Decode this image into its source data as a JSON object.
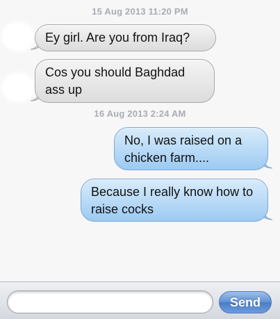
{
  "thread": {
    "timestamps": [
      "15 Aug 2013 11:20 PM",
      "16 Aug 2013 2:24 AM"
    ],
    "messages": [
      {
        "direction": "received",
        "text": "Ey girl. Are you from Iraq?"
      },
      {
        "direction": "received",
        "text": "Cos you should Baghdad ass up"
      },
      {
        "direction": "sent",
        "text": "No, I was raised on a chicken farm...."
      },
      {
        "direction": "sent",
        "text": "Because I really know how to raise cocks"
      }
    ]
  },
  "composer": {
    "input_value": "",
    "send_label": "Send"
  },
  "colors": {
    "received_bubble": "#e6e6e6",
    "sent_bubble": "#b5d8f7",
    "send_button": "#5f8fd3",
    "timestamp": "#a9acb2"
  }
}
